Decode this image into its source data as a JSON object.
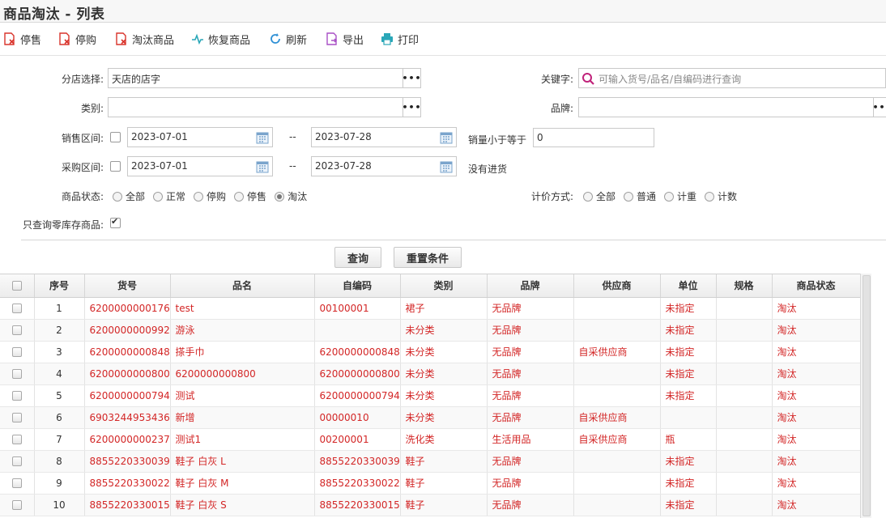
{
  "page": {
    "title": "商品淘汰 - 列表"
  },
  "toolbar": {
    "stop_sale": "停售",
    "stop_purchase": "停购",
    "eliminate": "淘汰商品",
    "restore": "恢复商品",
    "refresh": "刷新",
    "export": "导出",
    "print": "打印"
  },
  "filters": {
    "store_label": "分店选择:",
    "store_value": "天店的店字",
    "keyword_label": "关键字:",
    "keyword_placeholder": "可输入货号/品名/自编码进行查询",
    "category_label": "类别:",
    "brand_label": "品牌:",
    "sale_range_label": "销售区间:",
    "sale_from": "2023-07-01",
    "sale_to": "2023-07-28",
    "range_sep": "--",
    "qty_less_label": "销量小于等于",
    "qty_less_value": "0",
    "purchase_range_label": "采购区间:",
    "purchase_from": "2023-07-01",
    "purchase_to": "2023-07-28",
    "no_purchase_label": "没有进货",
    "status_label": "商品状态:",
    "status_options": [
      "全部",
      "正常",
      "停购",
      "停售",
      "淘汰"
    ],
    "status_selected": "淘汰",
    "pricing_label": "计价方式:",
    "pricing_options": [
      "全部",
      "普通",
      "计重",
      "计数"
    ],
    "zero_stock_label": "只查询零库存商品:"
  },
  "buttons": {
    "query": "查询",
    "reset": "重置条件"
  },
  "table": {
    "columns": [
      "序号",
      "货号",
      "品名",
      "自编码",
      "类别",
      "品牌",
      "供应商",
      "单位",
      "规格",
      "商品状态"
    ],
    "rows": [
      {
        "no": "1",
        "sku": "6200000000176",
        "name": "test",
        "code": "00100001",
        "cat": "裙子",
        "brand": "无品牌",
        "supplier": "",
        "unit": "未指定",
        "spec": "",
        "status": "淘汰"
      },
      {
        "no": "2",
        "sku": "6200000000992",
        "name": "游泳",
        "code": "",
        "cat": "未分类",
        "brand": "无品牌",
        "supplier": "",
        "unit": "未指定",
        "spec": "",
        "status": "淘汰"
      },
      {
        "no": "3",
        "sku": "6200000000848",
        "name": "搽手巾",
        "code": "6200000000848",
        "cat": "未分类",
        "brand": "无品牌",
        "supplier": "自采供应商",
        "unit": "未指定",
        "spec": "",
        "status": "淘汰"
      },
      {
        "no": "4",
        "sku": "6200000000800",
        "name": "6200000000800",
        "code": "6200000000800",
        "cat": "未分类",
        "brand": "无品牌",
        "supplier": "",
        "unit": "未指定",
        "spec": "",
        "status": "淘汰"
      },
      {
        "no": "5",
        "sku": "6200000000794",
        "name": "测试",
        "code": "6200000000794",
        "cat": "未分类",
        "brand": "无品牌",
        "supplier": "",
        "unit": "未指定",
        "spec": "",
        "status": "淘汰"
      },
      {
        "no": "6",
        "sku": "6903244953436",
        "name": "新增",
        "code": "00000010",
        "cat": "未分类",
        "brand": "无品牌",
        "supplier": "自采供应商",
        "unit": "",
        "spec": "",
        "status": "淘汰"
      },
      {
        "no": "7",
        "sku": "6200000000237",
        "name": "测试1",
        "code": "00200001",
        "cat": "洗化类",
        "brand": "生活用品",
        "supplier": "自采供应商",
        "unit": "瓶",
        "spec": "",
        "status": "淘汰"
      },
      {
        "no": "8",
        "sku": "8855220330039",
        "name": "鞋子 白灰 L",
        "code": "8855220330039",
        "cat": "鞋子",
        "brand": "无品牌",
        "supplier": "",
        "unit": "未指定",
        "spec": "",
        "status": "淘汰"
      },
      {
        "no": "9",
        "sku": "8855220330022",
        "name": "鞋子 白灰 M",
        "code": "8855220330022",
        "cat": "鞋子",
        "brand": "无品牌",
        "supplier": "",
        "unit": "未指定",
        "spec": "",
        "status": "淘汰"
      },
      {
        "no": "10",
        "sku": "8855220330015",
        "name": "鞋子 白灰 S",
        "code": "8855220330015",
        "cat": "鞋子",
        "brand": "无品牌",
        "supplier": "",
        "unit": "未指定",
        "spec": "",
        "status": "淘汰"
      }
    ]
  },
  "colors": {
    "row_text": "#d32626",
    "icon_red": "#d9342b",
    "icon_purple": "#a84fc6",
    "icon_blue": "#2d8fd5",
    "icon_teal": "#2aa7b8",
    "search_icon": "#c0227a"
  }
}
